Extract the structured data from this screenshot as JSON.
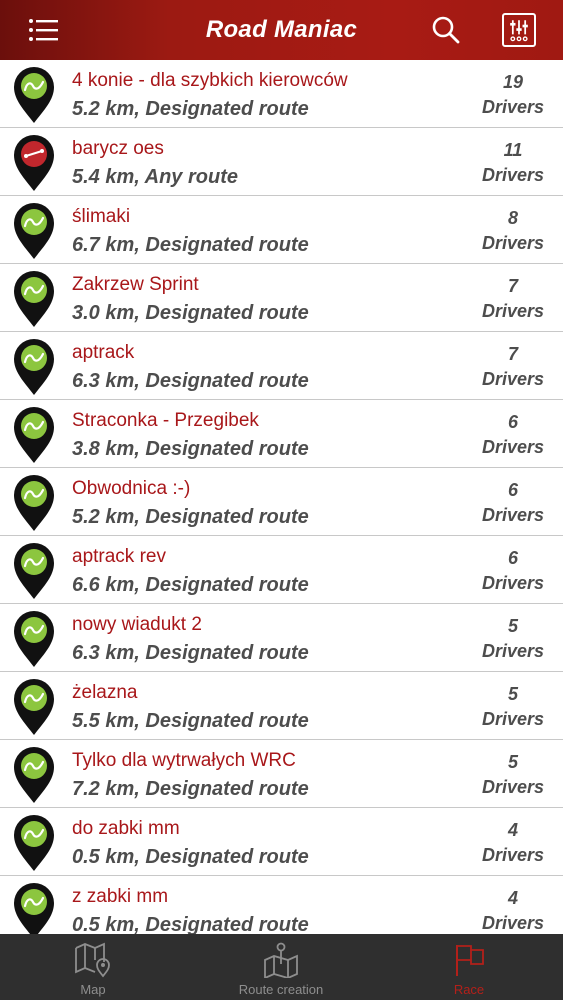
{
  "header": {
    "title": "Road Maniac",
    "menu_icon": "hamburger-menu-icon",
    "search_icon": "search-icon",
    "filter_icon": "sliders-filter-icon",
    "bg_color": "#a81b14"
  },
  "routes": [
    {
      "name": "4 konie - dla szybkich kierowców",
      "info": "5.2 km, Designated route",
      "count": "19",
      "unit": "Drivers",
      "type": "designated"
    },
    {
      "name": "barycz oes",
      "info": "5.4 km, Any route",
      "count": "11",
      "unit": "Drivers",
      "type": "any"
    },
    {
      "name": "ślimaki",
      "info": "6.7 km, Designated route",
      "count": "8",
      "unit": "Drivers",
      "type": "designated"
    },
    {
      "name": "Zakrzew Sprint",
      "info": "3.0 km, Designated route",
      "count": "7",
      "unit": "Drivers",
      "type": "designated"
    },
    {
      "name": "aptrack",
      "info": "6.3 km, Designated route",
      "count": "7",
      "unit": "Drivers",
      "type": "designated"
    },
    {
      "name": "Straconka - Przegibek",
      "info": "3.8 km, Designated route",
      "count": "6",
      "unit": "Drivers",
      "type": "designated"
    },
    {
      "name": "Obwodnica :-)",
      "info": "5.2 km, Designated route",
      "count": "6",
      "unit": "Drivers",
      "type": "designated"
    },
    {
      "name": "aptrack rev",
      "info": "6.6 km, Designated route",
      "count": "6",
      "unit": "Drivers",
      "type": "designated"
    },
    {
      "name": "nowy wiadukt 2",
      "info": "6.3 km, Designated route",
      "count": "5",
      "unit": "Drivers",
      "type": "designated"
    },
    {
      "name": "żelazna",
      "info": "5.5 km, Designated route",
      "count": "5",
      "unit": "Drivers",
      "type": "designated"
    },
    {
      "name": "Tylko dla wytrwałych WRC",
      "info": "7.2 km, Designated route",
      "count": "5",
      "unit": "Drivers",
      "type": "designated"
    },
    {
      "name": "do zabki mm",
      "info": "0.5 km, Designated route",
      "count": "4",
      "unit": "Drivers",
      "type": "designated"
    },
    {
      "name": "z zabki mm",
      "info": "0.5 km, Designated route",
      "count": "4",
      "unit": "Drivers",
      "type": "designated"
    }
  ],
  "tabs": [
    {
      "label": "Map",
      "icon": "map-pin-icon",
      "active": false
    },
    {
      "label": "Route creation",
      "icon": "route-creation-icon",
      "active": false
    },
    {
      "label": "Race",
      "icon": "race-flag-icon",
      "active": true
    }
  ],
  "colors": {
    "accent": "#a8171a",
    "pin_designated": "#8cc63f",
    "pin_any": "#c1272d",
    "tab_active": "#b3201a",
    "tab_inactive": "#8e8e8e"
  }
}
